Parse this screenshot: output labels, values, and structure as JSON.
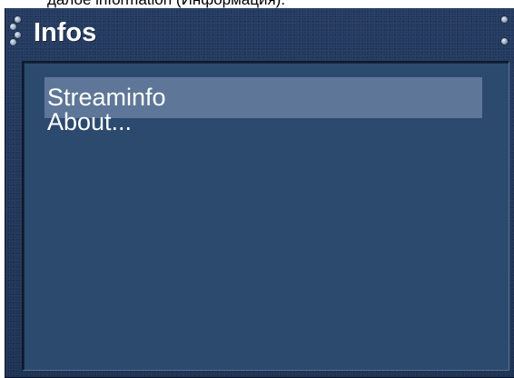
{
  "caption": {
    "text": "далое information (Информация)."
  },
  "window": {
    "title": "Infos"
  },
  "menu": {
    "items": [
      {
        "label": "Streaminfo",
        "selected": true
      },
      {
        "label": "About...",
        "selected": false
      }
    ]
  },
  "colors": {
    "frame": "#1f3557",
    "panel": "#2c4a6e",
    "highlight": "#5e7698",
    "text": "#ffffff"
  }
}
